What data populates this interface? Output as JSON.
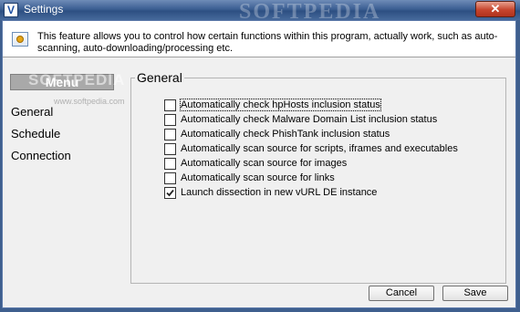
{
  "window": {
    "app_icon_glyph": "V",
    "title": "Settings",
    "close_glyph": "✕",
    "watermark": "SOFTPEDIA"
  },
  "info": {
    "icon": "settings-info-icon",
    "text": "This feature allows you to control how certain functions within this program, actually work, such as auto-scanning, auto-downloading/processing etc."
  },
  "sidebar": {
    "header": "Menu",
    "header_watermark": "SOFTPEDIA",
    "header_watermark_sub": "www.softpedia.com",
    "items": [
      {
        "label": "General"
      },
      {
        "label": "Schedule"
      },
      {
        "label": "Connection"
      }
    ]
  },
  "general": {
    "title": "General",
    "options": [
      {
        "label": "Automatically check hpHosts inclusion status",
        "checked": false
      },
      {
        "label": "Automatically check Malware Domain List inclusion status",
        "checked": false
      },
      {
        "label": "Automatically check PhishTank inclusion status",
        "checked": false
      },
      {
        "label": "Automatically scan source for scripts, iframes and executables",
        "checked": false
      },
      {
        "label": "Automatically scan source for images",
        "checked": false
      },
      {
        "label": "Automatically scan source for links",
        "checked": false
      },
      {
        "label": "Launch dissection in new vURL DE instance",
        "checked": true
      }
    ]
  },
  "buttons": {
    "cancel": "Cancel",
    "save": "Save"
  }
}
